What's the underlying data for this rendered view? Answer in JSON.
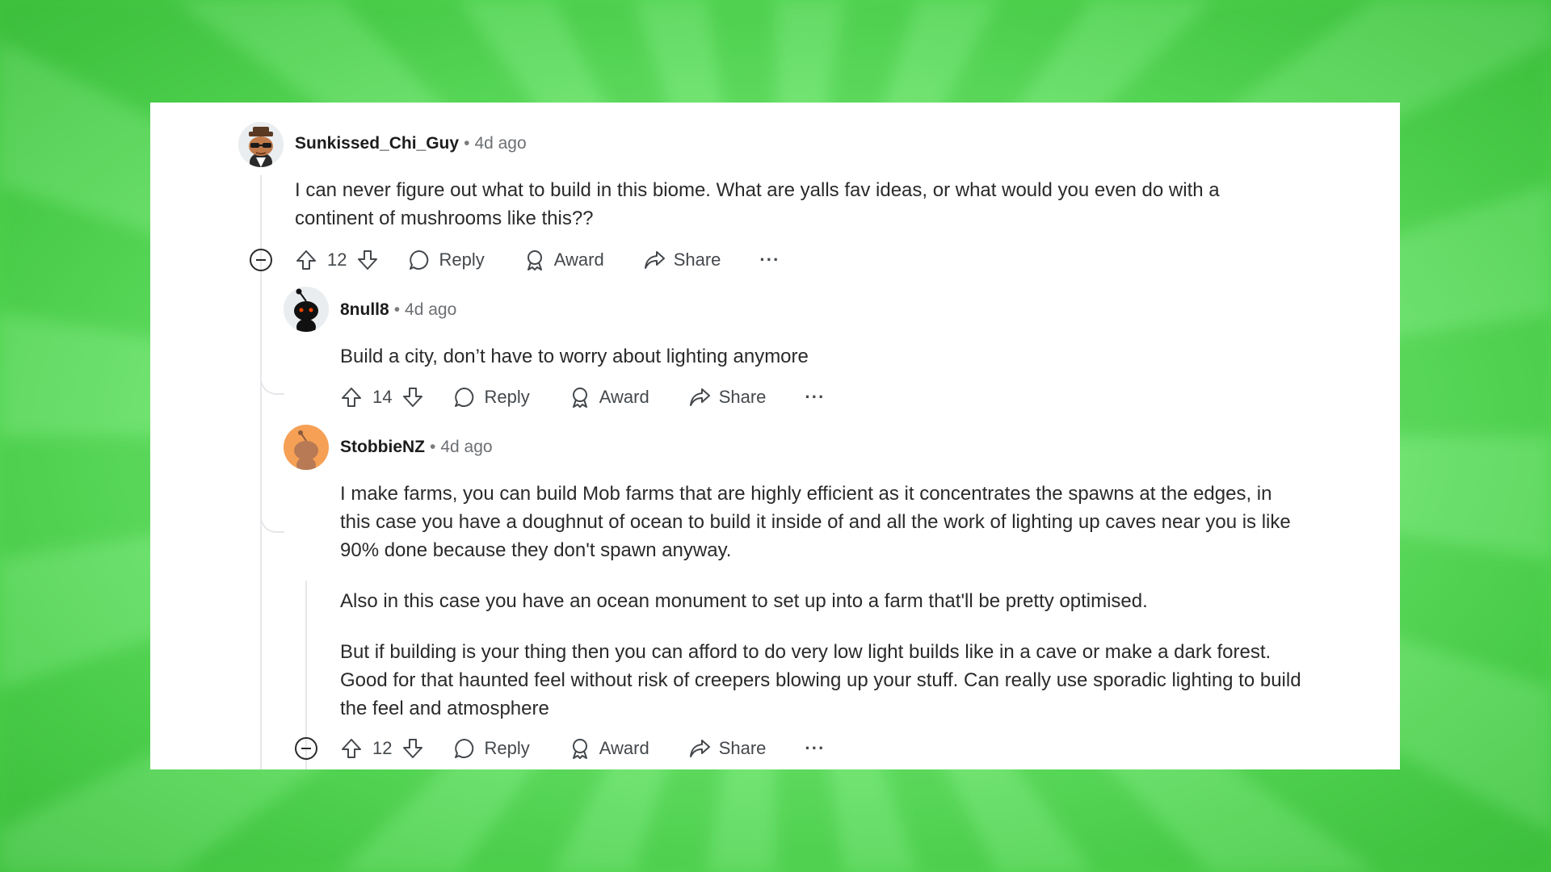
{
  "comments": [
    {
      "username": "Sunkissed_Chi_Guy",
      "time": "4d ago",
      "paragraphs": [
        "I can never figure out what to build in this biome. What are yalls fav ideas, or what would you even do with a continent of mushrooms like this??"
      ],
      "votes": "12",
      "avatar": "snoo-avatar-sunglasses-hat",
      "collapse_icon": "collapse-minus-icon"
    },
    {
      "username": "8null8",
      "time": "4d ago",
      "paragraphs": [
        "Build a city, don’t have to worry about lighting anymore"
      ],
      "votes": "14",
      "avatar": "snoo-avatar-black"
    },
    {
      "username": "StobbieNZ",
      "time": "4d ago",
      "paragraphs": [
        "I make farms, you can build Mob farms that are highly efficient as it concentrates the spawns at the edges, in this case you have a doughnut of ocean to build it inside of and all the work of lighting up caves near you is like 90% done because they don't spawn anyway.",
        "Also in this case you have an ocean monument to set up into a farm that'll be pretty optimised.",
        "But if building is your thing then you can afford to do very low light builds like in a cave or make a dark forest. Good for that haunted feel without risk of creepers blowing up your stuff. Can really use sporadic lighting to build the feel and atmosphere"
      ],
      "votes": "12",
      "avatar": "snoo-avatar-orange",
      "collapse_icon": "collapse-minus-icon"
    }
  ],
  "labels": {
    "separator": "•",
    "reply": "Reply",
    "award": "Award",
    "share": "Share",
    "more": "···"
  },
  "colors": {
    "background_green": "#6fe96f",
    "card": "#ffffff",
    "thread_line": "#e5e7ea",
    "text": "#2a2a2a",
    "action_text": "#44484c"
  }
}
